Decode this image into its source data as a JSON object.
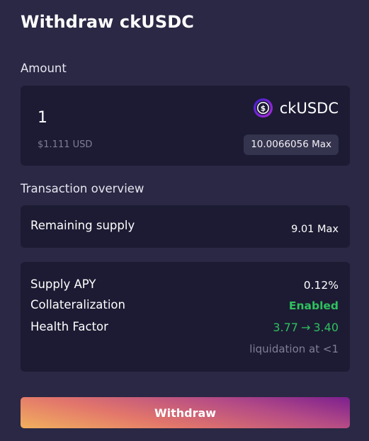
{
  "modal": {
    "title": "Withdraw ckUSDC"
  },
  "amount": {
    "label": "Amount",
    "value": "1",
    "usd_value": "$1.111 USD",
    "token_name": "ckUSDC",
    "token_icon": "usdc-token-icon",
    "max_label": "10.0066056 Max"
  },
  "overview": {
    "label": "Transaction overview",
    "remaining_supply_label": "Remaining supply",
    "remaining_supply_value": "9.01 Max",
    "supply_apy_label": "Supply APY",
    "supply_apy_value": "0.12%",
    "collateralization_label": "Collateralization",
    "collateralization_value": "Enabled",
    "health_factor_label": "Health Factor",
    "health_factor_from": "3.77",
    "health_factor_arrow": "→",
    "health_factor_to": "3.40",
    "liquidation_note": "liquidation at <1"
  },
  "actions": {
    "withdraw_label": "Withdraw"
  },
  "colors": {
    "background": "#2a2844",
    "card": "#1c1b33",
    "positive": "#2fc15e",
    "muted": "#7f7d98",
    "button_gradient_start": "#f2b05e",
    "button_gradient_end": "#7c1f8f"
  }
}
